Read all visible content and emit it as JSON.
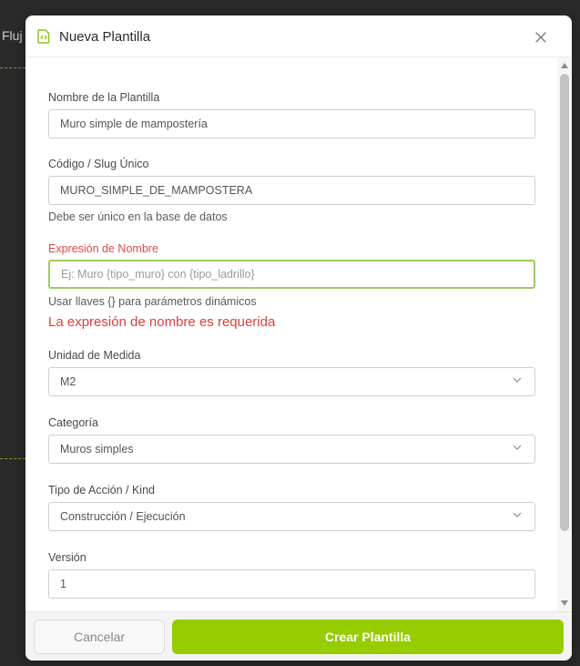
{
  "background": {
    "partial_text": "Fluj"
  },
  "modal": {
    "title": "Nueva Plantilla",
    "icon": "document-code-icon",
    "close_icon": "close-icon"
  },
  "form": {
    "template_name": {
      "label": "Nombre de la Plantilla",
      "value": "Muro simple de mampostería"
    },
    "slug": {
      "label": "Código / Slug Único",
      "value": "MURO_SIMPLE_DE_MAMPOSTERA",
      "help": "Debe ser único en la base de datos"
    },
    "name_expression": {
      "label": "Expresión de Nombre",
      "value": "",
      "placeholder": "Ej: Muro {tipo_muro} con {tipo_ladrillo}",
      "help": "Usar llaves {} para parámetros dinámicos",
      "error": "La expresión de nombre es requerida"
    },
    "unit": {
      "label": "Unidad de Medida",
      "value": "M2"
    },
    "category": {
      "label": "Categoría",
      "value": "Muros simples"
    },
    "action_kind": {
      "label": "Tipo de Acción / Kind",
      "value": "Construcción / Ejecución"
    },
    "version": {
      "label": "Versión",
      "value": "1"
    }
  },
  "footer": {
    "cancel_label": "Cancelar",
    "create_label": "Crear Plantilla"
  },
  "colors": {
    "accent": "#96cc00",
    "error": "#e03c3c",
    "focus_border": "#9ecb5f"
  }
}
